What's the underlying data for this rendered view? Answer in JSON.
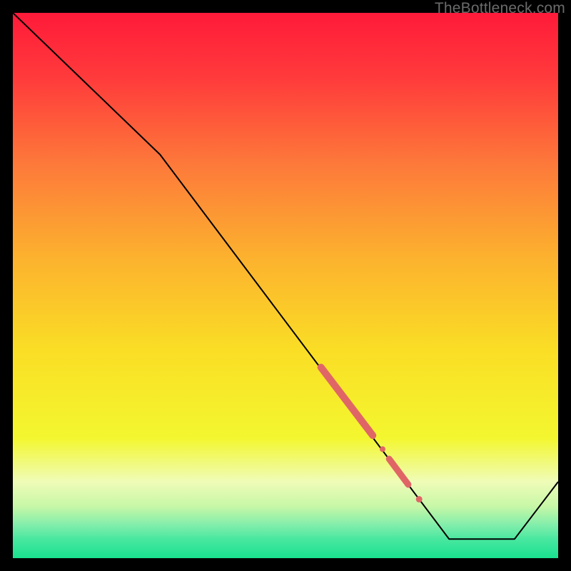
{
  "watermark": "TheBottleneck.com",
  "chart_data": {
    "type": "line",
    "title": "",
    "xlabel": "",
    "ylabel": "",
    "xlim": [
      0,
      100
    ],
    "ylim": [
      0,
      100
    ],
    "grid": false,
    "legend": false,
    "background_gradient": {
      "stops": [
        {
          "offset": 0.0,
          "color": "#ff1a3a"
        },
        {
          "offset": 0.12,
          "color": "#ff3b3b"
        },
        {
          "offset": 0.28,
          "color": "#fd7a3a"
        },
        {
          "offset": 0.45,
          "color": "#fcb22e"
        },
        {
          "offset": 0.62,
          "color": "#fade25"
        },
        {
          "offset": 0.78,
          "color": "#f3f72f"
        },
        {
          "offset": 0.86,
          "color": "#effcb8"
        },
        {
          "offset": 0.905,
          "color": "#c7f7a7"
        },
        {
          "offset": 0.94,
          "color": "#80eeab"
        },
        {
          "offset": 0.965,
          "color": "#49e7a0"
        },
        {
          "offset": 1.0,
          "color": "#19e18f"
        }
      ]
    },
    "series": [
      {
        "name": "bottleneck-curve",
        "x": [
          0,
          27,
          80,
          92,
          100
        ],
        "y": [
          100,
          74,
          3.5,
          3.5,
          14
        ],
        "stroke": "#000000",
        "stroke_width": 2
      }
    ],
    "markers": {
      "name": "highlight-segments",
      "color": "#e06666",
      "items": [
        {
          "type": "capsule",
          "x1": 56.5,
          "y1": 35.0,
          "x2": 66.0,
          "y2": 22.5,
          "width": 10
        },
        {
          "type": "dot",
          "x": 67.8,
          "y": 20.0,
          "r": 4
        },
        {
          "type": "capsule",
          "x1": 69.0,
          "y1": 18.2,
          "x2": 72.5,
          "y2": 13.5,
          "width": 9
        },
        {
          "type": "dot",
          "x": 74.5,
          "y": 10.8,
          "r": 4.5
        }
      ]
    }
  }
}
